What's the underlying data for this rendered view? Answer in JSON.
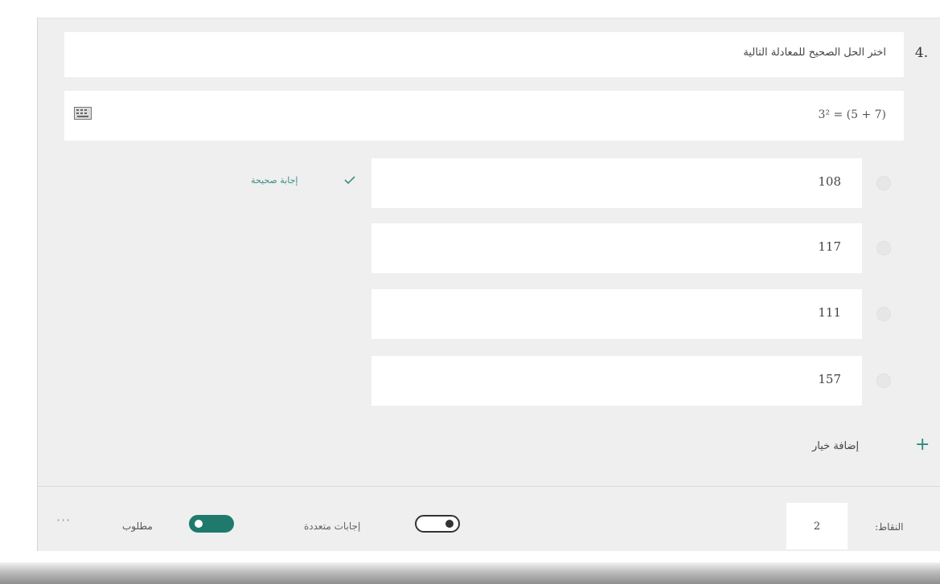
{
  "question": {
    "number": "4.",
    "title": "اختر الحل الصحيح للمعادلة التالية",
    "equation": "3² = (5 + 7)"
  },
  "options": [
    {
      "value": "108",
      "correct": true
    },
    {
      "value": "117",
      "correct": false
    },
    {
      "value": "111",
      "correct": false
    },
    {
      "value": "157",
      "correct": false
    }
  ],
  "correct_label": "إجابة صحيحة",
  "add_choice_label": "إضافة خيار",
  "footer": {
    "points_label": "النقاط:",
    "points_value": "2",
    "multi_answers_label": "إجابات متعددة",
    "required_label": "مطلوب",
    "more_label": "···"
  },
  "colors": {
    "accent": "#1f7a6c",
    "correct_text": "#3d8f86"
  },
  "icons": [
    "keyboard-icon",
    "checkmark-icon",
    "plus-icon",
    "more-options-icon"
  ]
}
